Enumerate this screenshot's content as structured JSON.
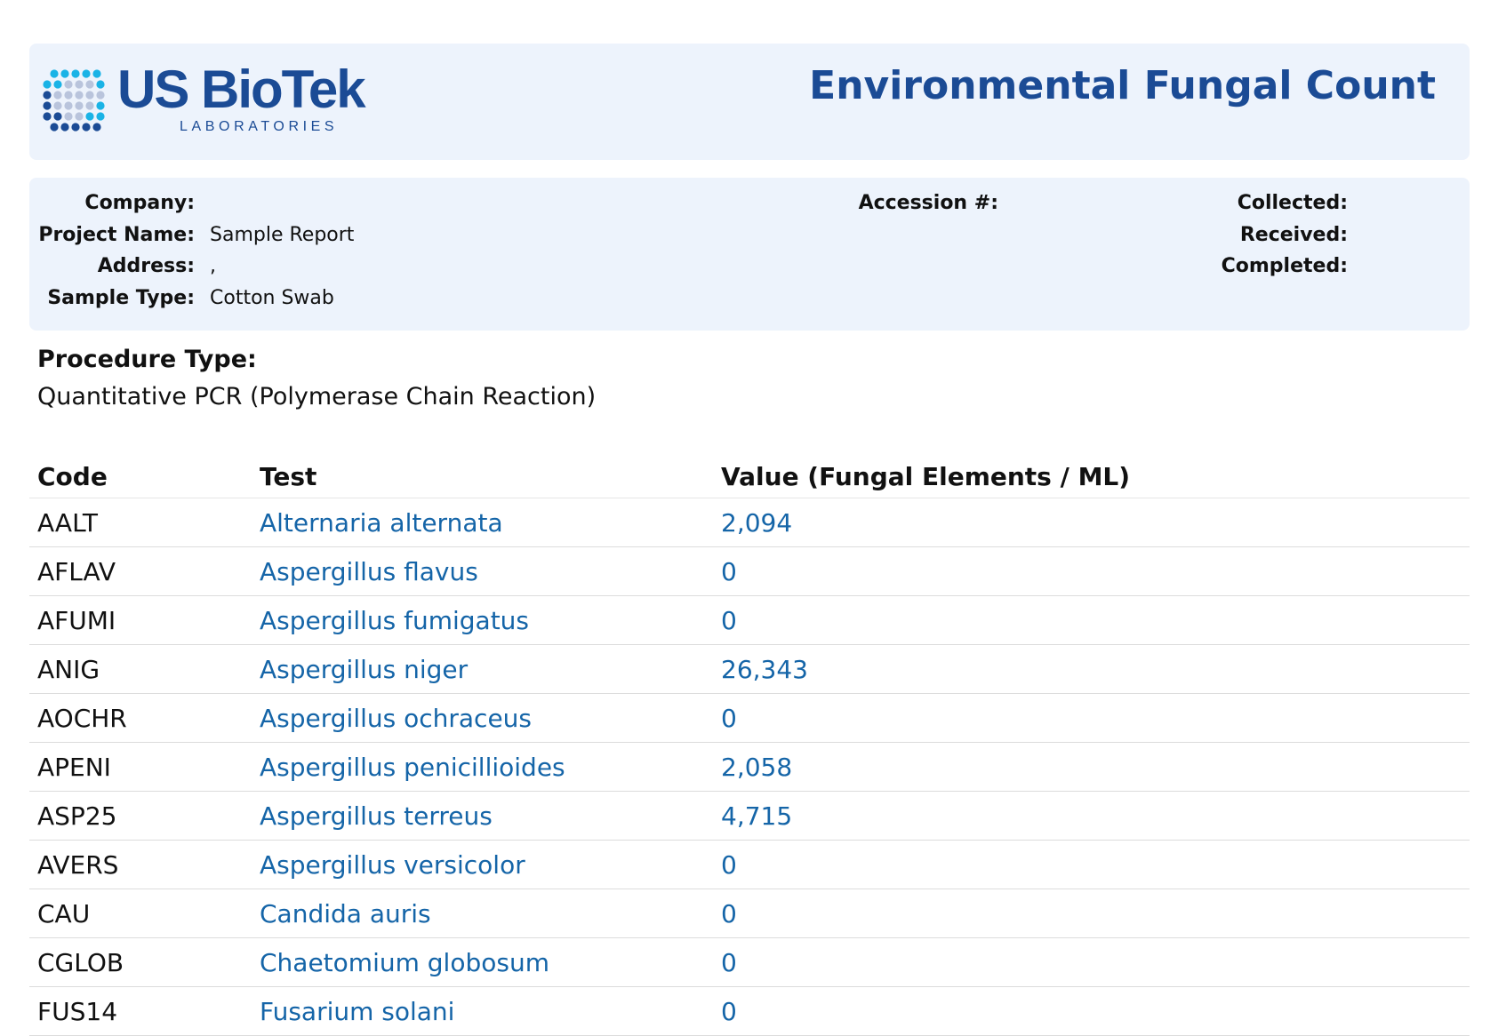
{
  "logo": {
    "name": "US BioTek",
    "subtitle": "LABORATORIES",
    "brand_color": "#1b4b95",
    "accent_color": "#1ab3e6"
  },
  "report_title": "Environmental Fungal Count",
  "info": {
    "company_label": "Company:",
    "company_value": "",
    "project_label": "Project Name:",
    "project_value": "Sample Report",
    "address_label": "Address:",
    "address_value": ",",
    "sample_type_label": "Sample Type:",
    "sample_type_value": "Cotton Swab",
    "accession_label": "Accession #:",
    "accession_value": "",
    "collected_label": "Collected:",
    "collected_value": "",
    "received_label": "Received:",
    "received_value": "",
    "completed_label": "Completed:",
    "completed_value": ""
  },
  "procedure": {
    "label": "Procedure Type:",
    "value": "Quantitative PCR (Polymerase Chain Reaction)"
  },
  "results": {
    "headers": {
      "code": "Code",
      "test": "Test",
      "value": "Value (Fungal Elements / ML)"
    },
    "rows": [
      {
        "code": "AALT",
        "test": "Alternaria alternata",
        "value": "2,094"
      },
      {
        "code": "AFLAV",
        "test": "Aspergillus flavus",
        "value": "0"
      },
      {
        "code": "AFUMI",
        "test": "Aspergillus fumigatus",
        "value": "0"
      },
      {
        "code": "ANIG",
        "test": "Aspergillus niger",
        "value": "26,343"
      },
      {
        "code": "AOCHR",
        "test": "Aspergillus ochraceus",
        "value": "0"
      },
      {
        "code": "APENI",
        "test": "Aspergillus penicillioides",
        "value": "2,058"
      },
      {
        "code": "ASP25",
        "test": "Aspergillus terreus",
        "value": "4,715"
      },
      {
        "code": "AVERS",
        "test": "Aspergillus versicolor",
        "value": "0"
      },
      {
        "code": "CAU",
        "test": "Candida auris",
        "value": "0"
      },
      {
        "code": "CGLOB",
        "test": "Chaetomium globosum",
        "value": "0"
      },
      {
        "code": "FUS14",
        "test": "Fusarium solani",
        "value": "0"
      }
    ]
  }
}
